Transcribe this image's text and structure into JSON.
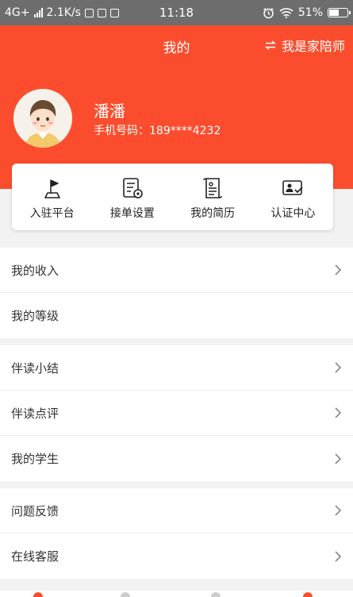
{
  "status_bar": {
    "network": "4G+",
    "speed": "2.1K/s",
    "time": "11:18",
    "battery": "51%"
  },
  "header": {
    "title": "我的",
    "switch_label": "我是家陪师",
    "background_color": "#fb4d2d"
  },
  "profile": {
    "name": "潘潘",
    "phone": "手机号码：189****4232"
  },
  "quick_actions": [
    {
      "label": "入驻平台",
      "icon": "flag-icon"
    },
    {
      "label": "接单设置",
      "icon": "order-settings-icon"
    },
    {
      "label": "我的简历",
      "icon": "resume-icon"
    },
    {
      "label": "认证中心",
      "icon": "id-card-check-icon"
    }
  ],
  "menu": {
    "income": "我的收入",
    "level": "我的等级",
    "summary": "伴读小结",
    "review": "伴读点评",
    "students": "我的学生",
    "feedback": "问题反馈",
    "service": "在线客服"
  }
}
